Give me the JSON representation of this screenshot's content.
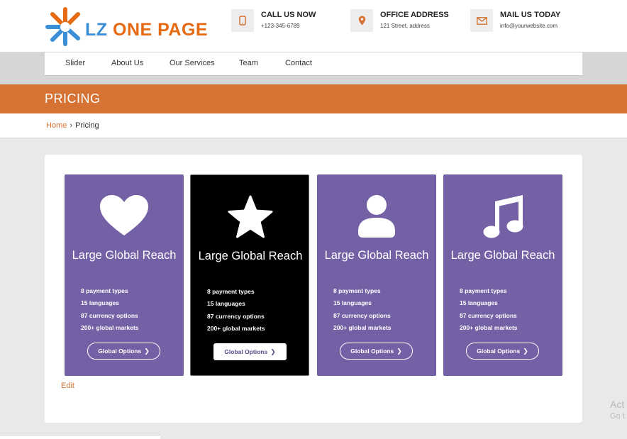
{
  "header": {
    "logo": {
      "text_prefix": "LZ",
      "text_rest": " ONE PAGE"
    },
    "contacts": [
      {
        "icon": "mobile-phone-icon",
        "title": "CALL US NOW",
        "subtitle": "+123-345-6789"
      },
      {
        "icon": "map-pin-icon",
        "title": "OFFICE ADDRESS",
        "subtitle": "121 Street, address"
      },
      {
        "icon": "envelope-icon",
        "title": "MAIL US TODAY",
        "subtitle": "info@yourwebsite.com"
      }
    ]
  },
  "nav": {
    "items": [
      "Slider",
      "About Us",
      "Our Services",
      "Team",
      "Contact"
    ]
  },
  "page": {
    "title": "PRICING"
  },
  "breadcrumb": {
    "home": "Home",
    "separator": "›",
    "current": "Pricing"
  },
  "cards": [
    {
      "icon": "heart-icon",
      "title": "Large Global Reach",
      "features": [
        "8 payment types",
        "15 languages",
        "87 currency options",
        "200+ global markets"
      ],
      "button": "Global Options",
      "style": "purple"
    },
    {
      "icon": "star-icon",
      "title": "Large Global Reach",
      "features": [
        "8 payment types",
        "15 languages",
        "87 currency options",
        "200+ global markets"
      ],
      "button": "Global Options",
      "style": "black"
    },
    {
      "icon": "user-icon",
      "title": "Large Global Reach",
      "features": [
        "8 payment types",
        "15 languages",
        "87 currency options",
        "200+ global markets"
      ],
      "button": "Global Options",
      "style": "purple"
    },
    {
      "icon": "music-note-icon",
      "title": "Large Global Reach",
      "features": [
        "8 payment types",
        "15 languages",
        "87 currency options",
        "200+ global markets"
      ],
      "button": "Global Options",
      "style": "purple"
    }
  ],
  "edit_link": "Edit",
  "watermark": {
    "line1": "Act",
    "line2": "Go t"
  },
  "colors": {
    "accent": "#d67334",
    "card_purple": "#7460a5",
    "card_dark": "#000000",
    "logo_blue": "#3b8fd6",
    "logo_orange": "#e66a14"
  }
}
